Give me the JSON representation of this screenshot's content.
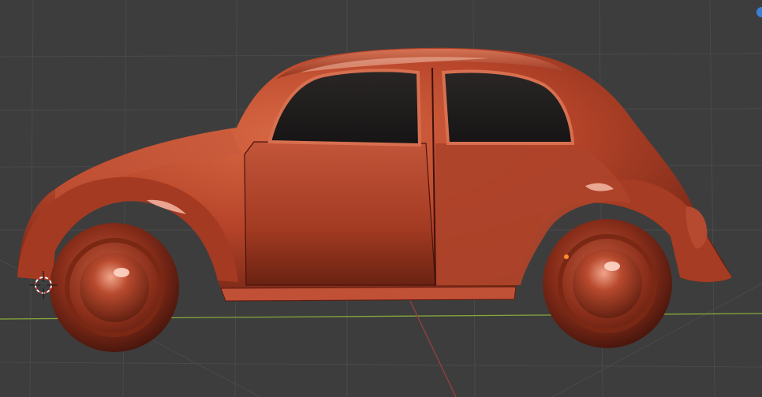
{
  "viewport": {
    "background_color": "#3d3d3d",
    "grid_line_color": "#4a4a4a",
    "x_axis_color": "#85a83c",
    "y_axis_color": "#9a3f3f"
  },
  "model": {
    "body_color": "#b8452a",
    "body_shadow_color": "#5a1a0e",
    "highlight_color": "#f4b9a4",
    "window_color": "#1c1a1a"
  },
  "overlay": {
    "cursor_3d_icon": "3d-cursor-icon",
    "origin_point_color": "#ff8a2b",
    "navigation_dot_color": "#3b80d4"
  }
}
